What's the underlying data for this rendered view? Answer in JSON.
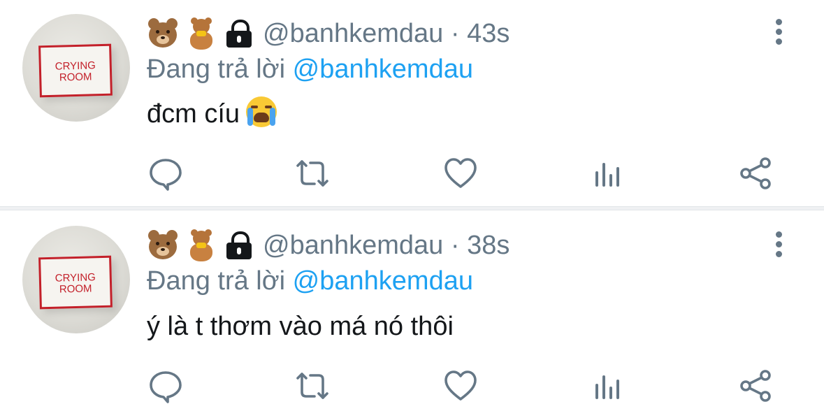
{
  "tweets": [
    {
      "avatar_text": "CRYING\nROOM",
      "handle": "@banhkemdau",
      "separator": "·",
      "time": "43s",
      "replying_prefix": "Đang trả lời",
      "replying_to": "@banhkemdau",
      "text": "đcm cíu",
      "text_emoji": "loudly-crying-face"
    },
    {
      "avatar_text": "CRYING\nROOM",
      "handle": "@banhkemdau",
      "separator": "·",
      "time": "38s",
      "replying_prefix": "Đang trả lời",
      "replying_to": "@banhkemdau",
      "text": "ý là t thơm vào má nó thôi",
      "text_emoji": ""
    }
  ],
  "colors": {
    "secondary_text": "#657786",
    "link": "#1da1f2",
    "primary_text": "#14171a",
    "divider": "#eff1f3"
  },
  "icons": [
    "bear-face-icon",
    "teddy-bear-icon",
    "lock-icon",
    "more-vertical-icon",
    "reply-icon",
    "retweet-icon",
    "like-icon",
    "analytics-icon",
    "share-icon"
  ]
}
